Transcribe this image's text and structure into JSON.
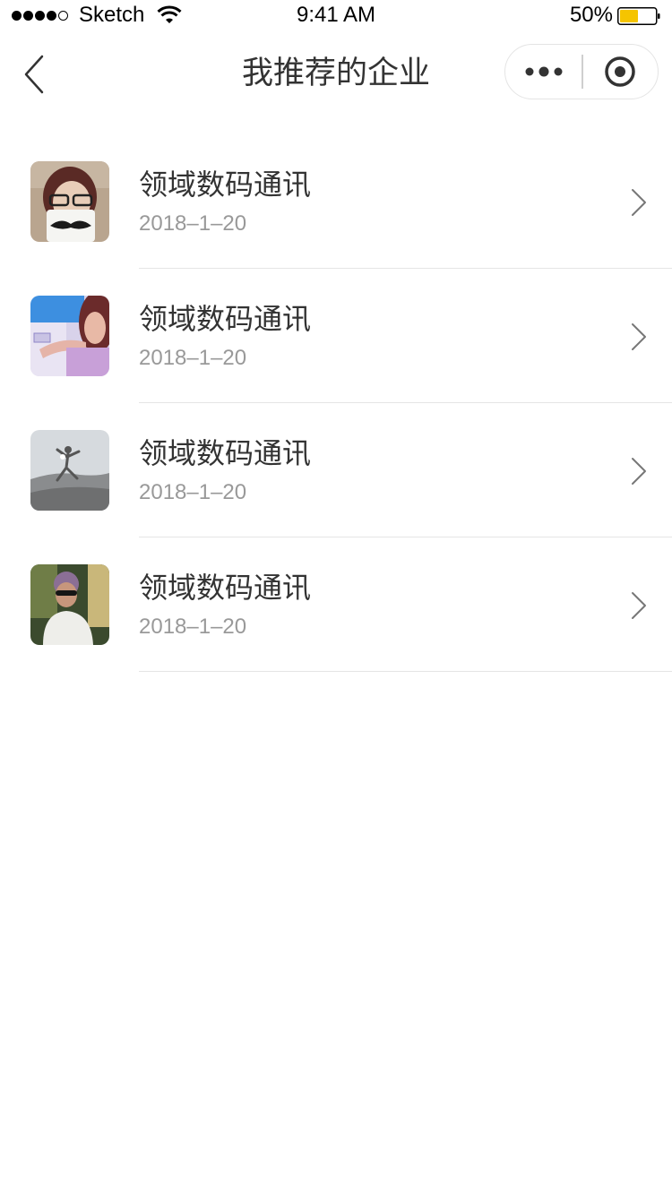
{
  "status_bar": {
    "carrier": "Sketch",
    "time": "9:41 AM",
    "battery": "50%",
    "battery_level": 0.5,
    "signal_bars": 4,
    "signal_total": 5
  },
  "nav": {
    "title": "我推荐的企业",
    "back_icon": "chevron-left-icon",
    "more_icon": "more-dots-icon",
    "close_icon": "target-close-icon"
  },
  "items": [
    {
      "name": "领域数码通讯",
      "date": "2018–1–20",
      "avatar": "avatar-woman-mug"
    },
    {
      "name": "领域数码通讯",
      "date": "2018–1–20",
      "avatar": "avatar-woman-blue"
    },
    {
      "name": "领域数码通讯",
      "date": "2018–1–20",
      "avatar": "avatar-jumping-person"
    },
    {
      "name": "领域数码通讯",
      "date": "2018–1–20",
      "avatar": "avatar-woman-sunglasses"
    }
  ],
  "colors": {
    "text_primary": "#333333",
    "text_secondary": "#999999",
    "divider": "#e5e5e5",
    "battery_fill": "#f5c400"
  }
}
